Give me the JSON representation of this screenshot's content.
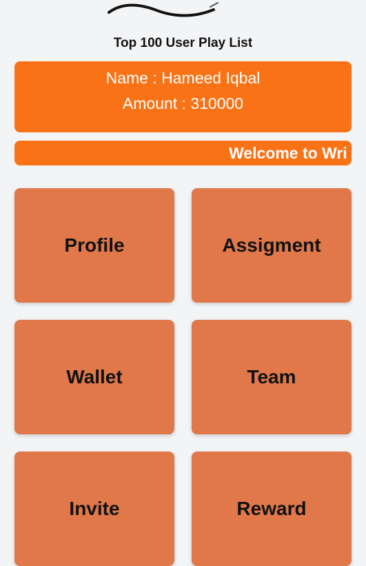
{
  "page_title": "Top 100 User Play List",
  "user": {
    "name_line": "Name : Hameed Iqbal",
    "amount_line": "Amount : 310000"
  },
  "marquee_text": "Welcome to Wri",
  "tiles": {
    "profile": "Profile",
    "assignment": "Assigment",
    "wallet": "Wallet",
    "team": "Team",
    "invite": "Invite",
    "reward": "Reward"
  },
  "colors": {
    "accent": "#f97316",
    "tile": "#e0784a",
    "background": "#f3f4f6"
  }
}
